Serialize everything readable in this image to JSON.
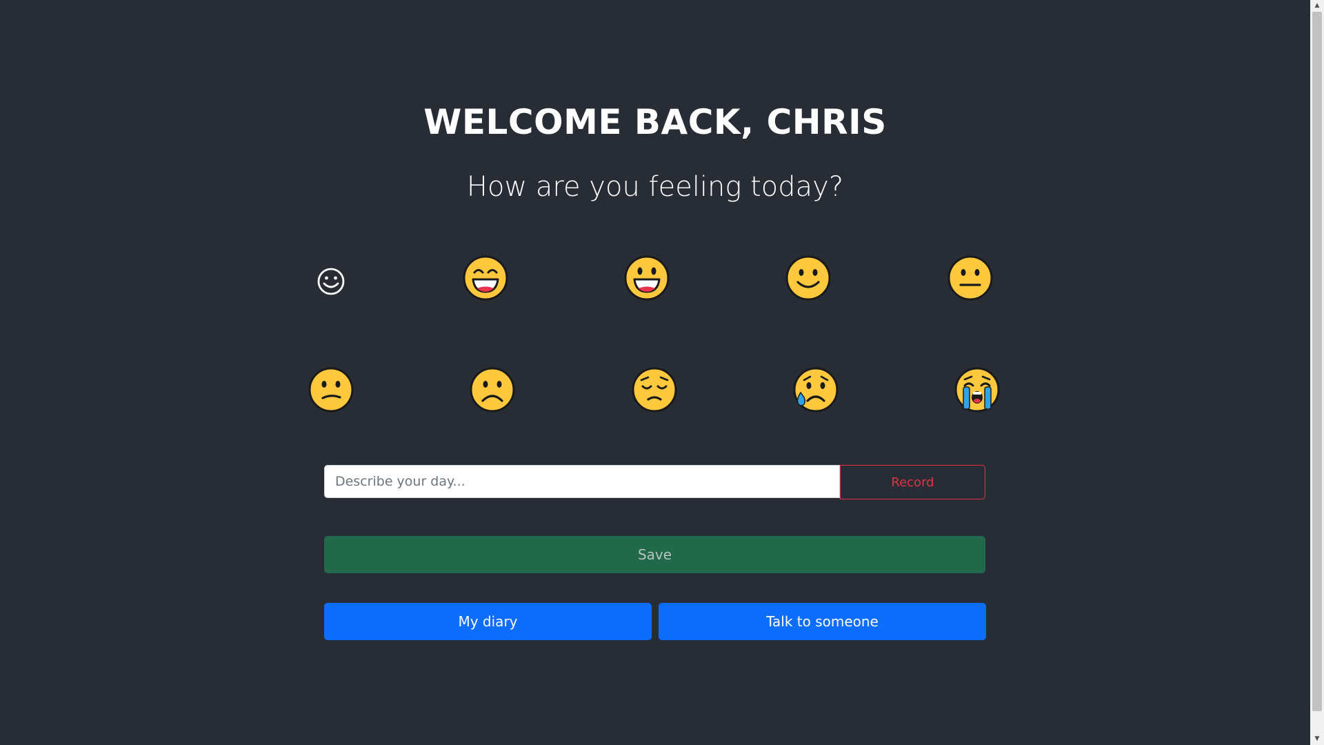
{
  "header": {
    "title": "WELCOME BACK, CHRIS",
    "subtitle": "How are you feeling today?"
  },
  "moods": [
    {
      "icon": "smiling-face-outline-icon"
    },
    {
      "icon": "grinning-smiling-eyes-icon"
    },
    {
      "icon": "grinning-face-icon"
    },
    {
      "icon": "slightly-smiling-face-icon"
    },
    {
      "icon": "neutral-face-icon"
    },
    {
      "icon": "confused-face-icon"
    },
    {
      "icon": "frowning-face-icon"
    },
    {
      "icon": "pensive-face-icon"
    },
    {
      "icon": "sad-relieved-face-icon"
    },
    {
      "icon": "loudly-crying-face-icon"
    }
  ],
  "entry": {
    "placeholder": "Describe your day...",
    "record_label": "Record",
    "save_label": "Save"
  },
  "nav": {
    "diary_label": "My diary",
    "talk_label": "Talk to someone"
  },
  "colors": {
    "background": "#282c35",
    "emoji_yellow": "#ffc83d",
    "record_red": "#dc3545",
    "save_green": "#21694a",
    "primary_blue": "#0d6efd"
  }
}
